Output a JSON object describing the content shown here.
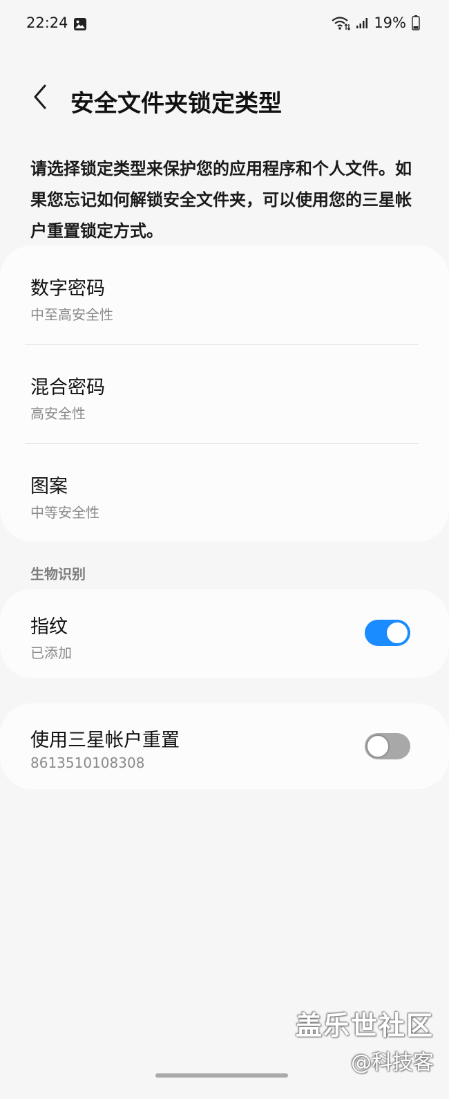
{
  "status_bar": {
    "time": "22:24",
    "gallery_icon": "gallery-icon",
    "wifi_icon": "wifi-icon",
    "signal_icon": "signal-icon",
    "battery_percent": "19%",
    "battery_level": 0.19
  },
  "header": {
    "back_icon": "chevron-left-icon",
    "title": "安全文件夹锁定类型"
  },
  "description": "请选择锁定类型来保护您的应用程序和个人文件。如果您忘记如何解锁安全文件夹，可以使用您的三星帐户重置锁定方式。",
  "lock_types": [
    {
      "title": "数字密码",
      "subtitle": "中至高安全性"
    },
    {
      "title": "混合密码",
      "subtitle": "高安全性"
    },
    {
      "title": "图案",
      "subtitle": "中等安全性"
    }
  ],
  "biometrics": {
    "section_label": "生物识别",
    "fingerprint": {
      "title": "指纹",
      "subtitle": "已添加",
      "enabled": true
    }
  },
  "samsung_reset": {
    "title": "使用三星帐户重置",
    "subtitle": "8613510108308",
    "enabled": false
  },
  "watermark": {
    "line1": "盖乐世社区",
    "line2": "@科技客"
  },
  "colors": {
    "accent": "#1a8cff",
    "background": "#f6f6f6",
    "card": "#fcfcfc"
  }
}
